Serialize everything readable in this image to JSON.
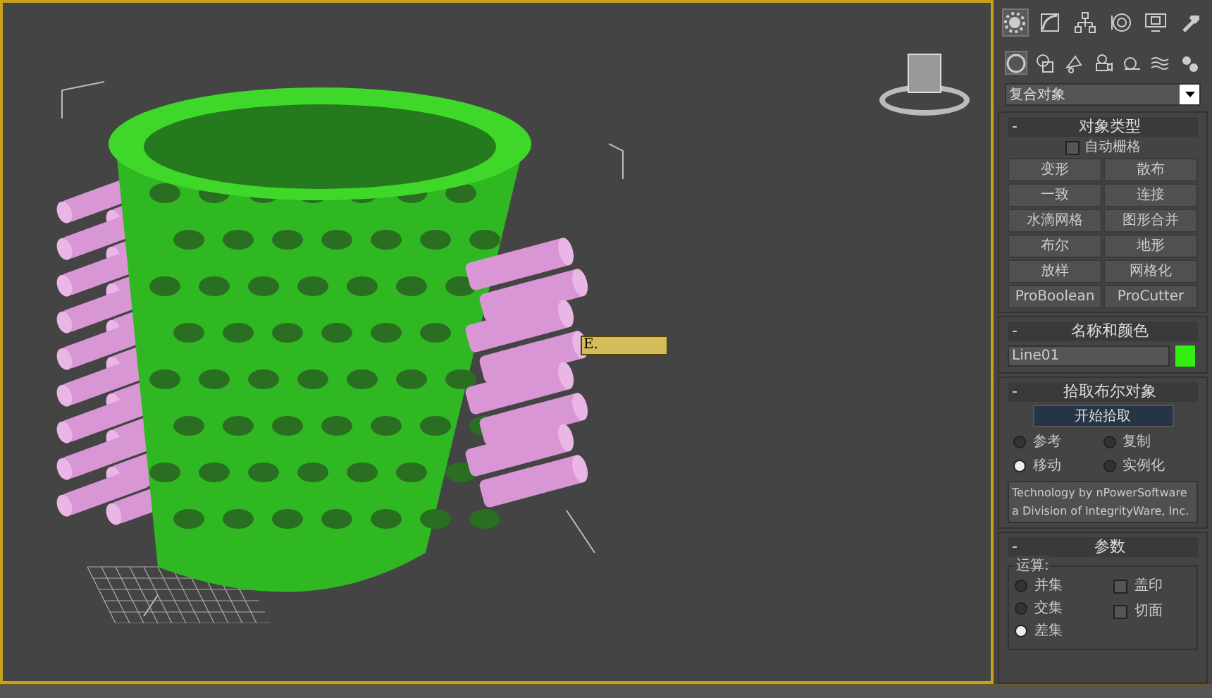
{
  "viewport": {
    "tooltip": "E."
  },
  "command_panel": {
    "main_tabs": [
      {
        "selected": true
      },
      {
        "selected": false
      },
      {
        "selected": false
      },
      {
        "selected": false
      },
      {
        "selected": false
      },
      {
        "selected": false
      }
    ],
    "category_tabs": [
      {
        "selected": true
      },
      {
        "selected": false
      },
      {
        "selected": false
      },
      {
        "selected": false
      },
      {
        "selected": false
      },
      {
        "selected": false
      },
      {
        "selected": false
      }
    ],
    "dropdown": {
      "value": "复合对象"
    },
    "object_type": {
      "toggle": "-",
      "title": "对象类型",
      "autogrid": {
        "label": "自动栅格",
        "checked": false
      },
      "buttons": [
        "变形",
        "散布",
        "一致",
        "连接",
        "水滴网格",
        "图形合并",
        "布尔",
        "地形",
        "放样",
        "网格化",
        "ProBoolean",
        "ProCutter"
      ]
    },
    "name_color": {
      "toggle": "-",
      "title": "名称和颜色",
      "name": "Line01",
      "color": "#33ee11"
    },
    "pick_boolean": {
      "toggle": "-",
      "title": "拾取布尔对象",
      "button": "开始拾取",
      "options": [
        {
          "label": "参考",
          "selected": false
        },
        {
          "label": "复制",
          "selected": false
        },
        {
          "label": "移动",
          "selected": true
        },
        {
          "label": "实例化",
          "selected": false
        }
      ],
      "credit": "Technology by nPowerSoftware a Division of IntegrityWare, Inc."
    },
    "parameters": {
      "toggle": "-",
      "title": "参数",
      "group": "运算:",
      "operations": [
        {
          "label": "并集",
          "selected": false
        },
        {
          "label": "交集",
          "selected": false
        },
        {
          "label": "差集",
          "selected": true
        }
      ],
      "checks": [
        {
          "label": "盖印",
          "checked": false
        },
        {
          "label": "切面",
          "checked": false
        }
      ]
    }
  }
}
